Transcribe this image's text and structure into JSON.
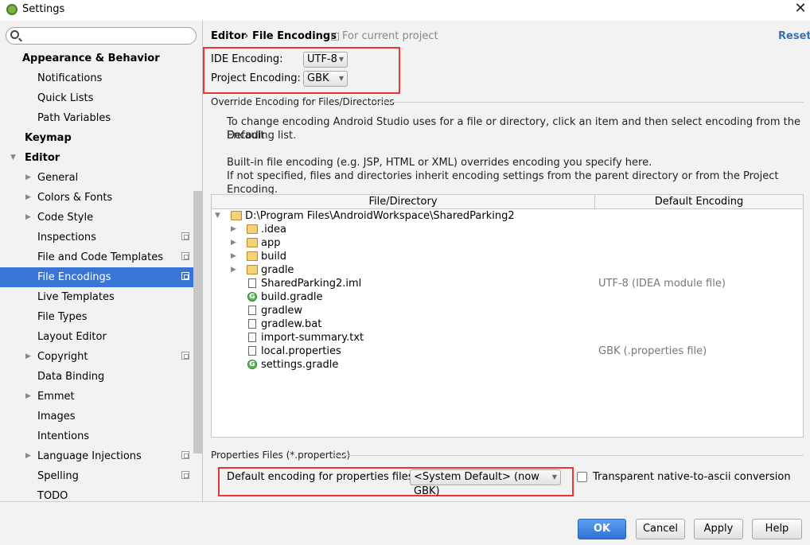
{
  "window": {
    "title": "Settings",
    "close_glyph": "✕"
  },
  "sidebar": {
    "search_placeholder": "",
    "items": [
      {
        "label": "Appearance & Behavior",
        "bold": true,
        "level": 0,
        "arrow": ""
      },
      {
        "label": "Notifications",
        "level": 1,
        "arrow": ""
      },
      {
        "label": "Quick Lists",
        "level": 1,
        "arrow": ""
      },
      {
        "label": "Path Variables",
        "level": 1,
        "arrow": ""
      },
      {
        "label": "Keymap",
        "bold": true,
        "level": 0,
        "arrow": ""
      },
      {
        "label": "Editor",
        "bold": true,
        "level": 0,
        "arrow": "▼"
      },
      {
        "label": "General",
        "level": 1,
        "arrow": "▶"
      },
      {
        "label": "Colors & Fonts",
        "level": 1,
        "arrow": "▶"
      },
      {
        "label": "Code Style",
        "level": 1,
        "arrow": "▶"
      },
      {
        "label": "Inspections",
        "level": 1,
        "arrow": "",
        "project": true
      },
      {
        "label": "File and Code Templates",
        "level": 1,
        "arrow": "",
        "project": true
      },
      {
        "label": "File Encodings",
        "level": 1,
        "arrow": "",
        "project": true,
        "selected": true
      },
      {
        "label": "Live Templates",
        "level": 1,
        "arrow": ""
      },
      {
        "label": "File Types",
        "level": 1,
        "arrow": ""
      },
      {
        "label": "Layout Editor",
        "level": 1,
        "arrow": ""
      },
      {
        "label": "Copyright",
        "level": 1,
        "arrow": "▶",
        "project": true
      },
      {
        "label": "Data Binding",
        "level": 1,
        "arrow": ""
      },
      {
        "label": "Emmet",
        "level": 1,
        "arrow": "▶"
      },
      {
        "label": "Images",
        "level": 1,
        "arrow": ""
      },
      {
        "label": "Intentions",
        "level": 1,
        "arrow": ""
      },
      {
        "label": "Language Injections",
        "level": 1,
        "arrow": "▶",
        "project": true
      },
      {
        "label": "Spelling",
        "level": 1,
        "arrow": "",
        "project": true
      },
      {
        "label": "TODO",
        "level": 1,
        "arrow": ""
      }
    ]
  },
  "header": {
    "crumb1": "Editor",
    "sep": "›",
    "crumb2": "File Encodings",
    "scope": "For current project",
    "reset": "Reset"
  },
  "encoding": {
    "ide_label": "IDE Encoding:",
    "ide_value": "UTF-8",
    "project_label": "Project Encoding:",
    "project_value": "GBK"
  },
  "override": {
    "title": "Override Encoding for Files/Directories",
    "info_line1": "To change encoding Android Studio uses for a file or directory, click an item and then select encoding from the Default",
    "info_line2": "Encoding list.",
    "info_line3": "Built-in file encoding (e.g. JSP, HTML or XML) overrides encoding you specify here.",
    "info_line4": "If not specified, files and directories inherit encoding settings from the parent directory or from the Project Encoding."
  },
  "table": {
    "col_file": "File/Directory",
    "col_enc": "Default Encoding",
    "rows": [
      {
        "name": "D:\\Program Files\\AndroidWorkspace\\SharedParking2",
        "type": "folder",
        "indent": 0,
        "arrow": "▼",
        "enc": ""
      },
      {
        "name": ".idea",
        "type": "folder",
        "indent": 1,
        "arrow": "▶",
        "enc": ""
      },
      {
        "name": "app",
        "type": "folder",
        "indent": 1,
        "arrow": "▶",
        "enc": ""
      },
      {
        "name": "build",
        "type": "folder",
        "indent": 1,
        "arrow": "▶",
        "enc": ""
      },
      {
        "name": "gradle",
        "type": "folder",
        "indent": 1,
        "arrow": "▶",
        "enc": ""
      },
      {
        "name": "SharedParking2.iml",
        "type": "file",
        "indent": 1,
        "arrow": "",
        "enc": "UTF-8 (IDEA module file)"
      },
      {
        "name": "build.gradle",
        "type": "gradle",
        "indent": 1,
        "arrow": "",
        "enc": ""
      },
      {
        "name": "gradlew",
        "type": "file",
        "indent": 1,
        "arrow": "",
        "enc": ""
      },
      {
        "name": "gradlew.bat",
        "type": "file",
        "indent": 1,
        "arrow": "",
        "enc": ""
      },
      {
        "name": "import-summary.txt",
        "type": "file",
        "indent": 1,
        "arrow": "",
        "enc": ""
      },
      {
        "name": "local.properties",
        "type": "file",
        "indent": 1,
        "arrow": "",
        "enc": "GBK (.properties file)"
      },
      {
        "name": "settings.gradle",
        "type": "gradle",
        "indent": 1,
        "arrow": "",
        "enc": ""
      }
    ]
  },
  "properties": {
    "title": "Properties Files (*.properties)",
    "default_label": "Default encoding for properties files:",
    "default_value": "<System Default> (now GBK)",
    "native_label": "Transparent native-to-ascii conversion",
    "native_checked": false
  },
  "buttons": {
    "ok": "OK",
    "cancel": "Cancel",
    "apply": "Apply",
    "help": "Help"
  }
}
